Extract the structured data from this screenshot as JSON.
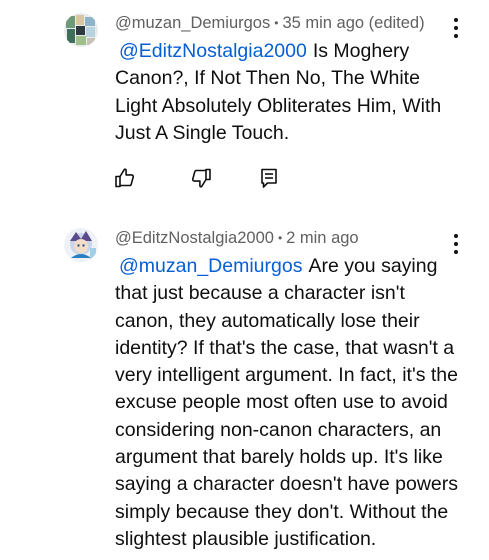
{
  "comments": [
    {
      "author": "@muzan_Demiurgos",
      "separator": "•",
      "time": "35 min ago (edited)",
      "mention": "@EditzNostalgia2000",
      "text": "Is Moghery Canon?, If Not Then No, The White Light Absolutely Obliterates Him, With Just A Single Touch.",
      "avatar_icon": "avatar-mosaic-icon"
    },
    {
      "author": "@EditzNostalgia2000",
      "separator": "•",
      "time": "2 min ago",
      "mention": "@muzan_Demiurgos",
      "text": "Are you saying that just because a character isn't canon, they automatically lose their identity? If that's the case, that wasn't a very intelligent argument. In fact, it's the excuse people most often use to avoid considering non-canon characters, an argument that barely holds up. It's like saying a character doesn't have powers simply because they don't. Without the slightest plausible justification.",
      "avatar_icon": "avatar-character-icon"
    }
  ],
  "actions": {
    "like_icon": "thumb-up-icon",
    "dislike_icon": "thumb-down-icon",
    "reply_icon": "reply-icon"
  },
  "colors": {
    "mention": "#065fd4",
    "meta": "#606060",
    "text": "#0f0f0f"
  }
}
